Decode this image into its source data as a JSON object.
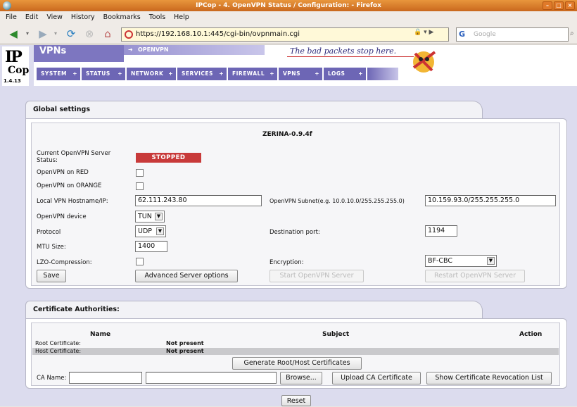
{
  "window": {
    "title": "IPCop - 4. OpenVPN Status / Configuration: - Firefox"
  },
  "menu": [
    "File",
    "Edit",
    "View",
    "History",
    "Bookmarks",
    "Tools",
    "Help"
  ],
  "nav": {
    "url": "https://192.168.10.1:445/cgi-bin/ovpnmain.cgi",
    "search_placeholder": "Google"
  },
  "header": {
    "logo_ip": "IP",
    "logo_cop": "Cop",
    "version": "1.4.13",
    "section": "VPNs",
    "crumb": "OPENVPN",
    "slogan": "The bad packets stop here.",
    "menu": [
      {
        "label": "SYSTEM"
      },
      {
        "label": "STATUS"
      },
      {
        "label": "NETWORK"
      },
      {
        "label": "SERVICES"
      },
      {
        "label": "FIREWALL"
      },
      {
        "label": "VPNS"
      },
      {
        "label": "LOGS"
      }
    ]
  },
  "global": {
    "title": "Global settings",
    "server_name": "ZERINA-0.9.4f",
    "status_label": "Current OpenVPN Server Status:",
    "status_value": "STOPPED",
    "red_label": "OpenVPN on RED",
    "orange_label": "OpenVPN on ORANGE",
    "hostname_label": "Local VPN Hostname/IP:",
    "hostname_value": "62.111.243.80",
    "subnet_label": "OpenVPN Subnet(e.g. 10.0.10.0/255.255.255.0)",
    "subnet_value": "10.159.93.0/255.255.255.0",
    "device_label": "OpenVPN device",
    "device_value": "TUN",
    "protocol_label": "Protocol",
    "protocol_value": "UDP",
    "port_label": "Destination port:",
    "port_value": "1194",
    "mtu_label": "MTU Size:",
    "mtu_value": "1400",
    "lzo_label": "LZO-Compression:",
    "encryption_label": "Encryption:",
    "encryption_value": "BF-CBC",
    "save": "Save",
    "advanced": "Advanced Server options",
    "start": "Start OpenVPN Server",
    "restart": "Restart OpenVPN Server"
  },
  "ca": {
    "title": "Certificate Authorities:",
    "col_name": "Name",
    "col_subject": "Subject",
    "col_action": "Action",
    "rows": [
      {
        "name": "Root Certificate:",
        "subject": "Not present"
      },
      {
        "name": "Host Certificate:",
        "subject": "Not present"
      }
    ],
    "generate": "Generate Root/Host Certificates",
    "ca_name_label": "CA Name:",
    "browse": "Browse...",
    "upload": "Upload CA Certificate",
    "revocation": "Show Certificate Revocation List",
    "reset": "Reset"
  }
}
